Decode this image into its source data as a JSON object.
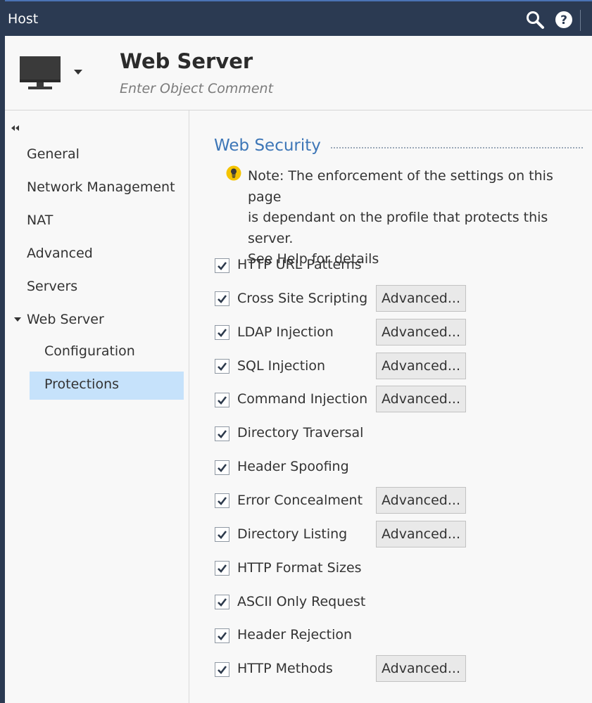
{
  "window": {
    "title": "Host"
  },
  "toolbar": {
    "search_icon": "search-icon",
    "help_icon": "help-icon"
  },
  "object": {
    "icon": "monitor-icon",
    "name": "Web Server",
    "comment_placeholder": "Enter Object Comment"
  },
  "nav": {
    "items": [
      "General",
      "Network Management",
      "NAT",
      "Advanced",
      "Servers",
      "Web Server"
    ],
    "sub_items": [
      "Configuration",
      "Protections"
    ],
    "active": "Protections"
  },
  "section": {
    "title": "Web Security",
    "note_lines": [
      "Note: The enforcement of the settings on this page",
      "is dependant on the profile that protects this server.",
      "See Help for details"
    ]
  },
  "protections": [
    {
      "label": "HTTP URL Patterns",
      "checked": true,
      "advanced": false
    },
    {
      "label": "Cross Site Scripting",
      "checked": true,
      "advanced": true
    },
    {
      "label": "LDAP Injection",
      "checked": true,
      "advanced": true
    },
    {
      "label": "SQL Injection",
      "checked": true,
      "advanced": true
    },
    {
      "label": "Command Injection",
      "checked": true,
      "advanced": true
    },
    {
      "label": "Directory Traversal",
      "checked": true,
      "advanced": false
    },
    {
      "label": "Header Spoofing",
      "checked": true,
      "advanced": false
    },
    {
      "label": "Error Concealment",
      "checked": true,
      "advanced": true
    },
    {
      "label": "Directory Listing",
      "checked": true,
      "advanced": true
    },
    {
      "label": "HTTP Format Sizes",
      "checked": true,
      "advanced": false
    },
    {
      "label": "ASCII Only Request",
      "checked": true,
      "advanced": false
    },
    {
      "label": "Header Rejection",
      "checked": true,
      "advanced": false
    },
    {
      "label": "HTTP Methods",
      "checked": true,
      "advanced": true
    }
  ],
  "buttons": {
    "advanced_label": "Advanced..."
  },
  "colors": {
    "titlebar": "#2b3a52",
    "accent": "#3d76b7",
    "selection": "#c6e2fb"
  }
}
